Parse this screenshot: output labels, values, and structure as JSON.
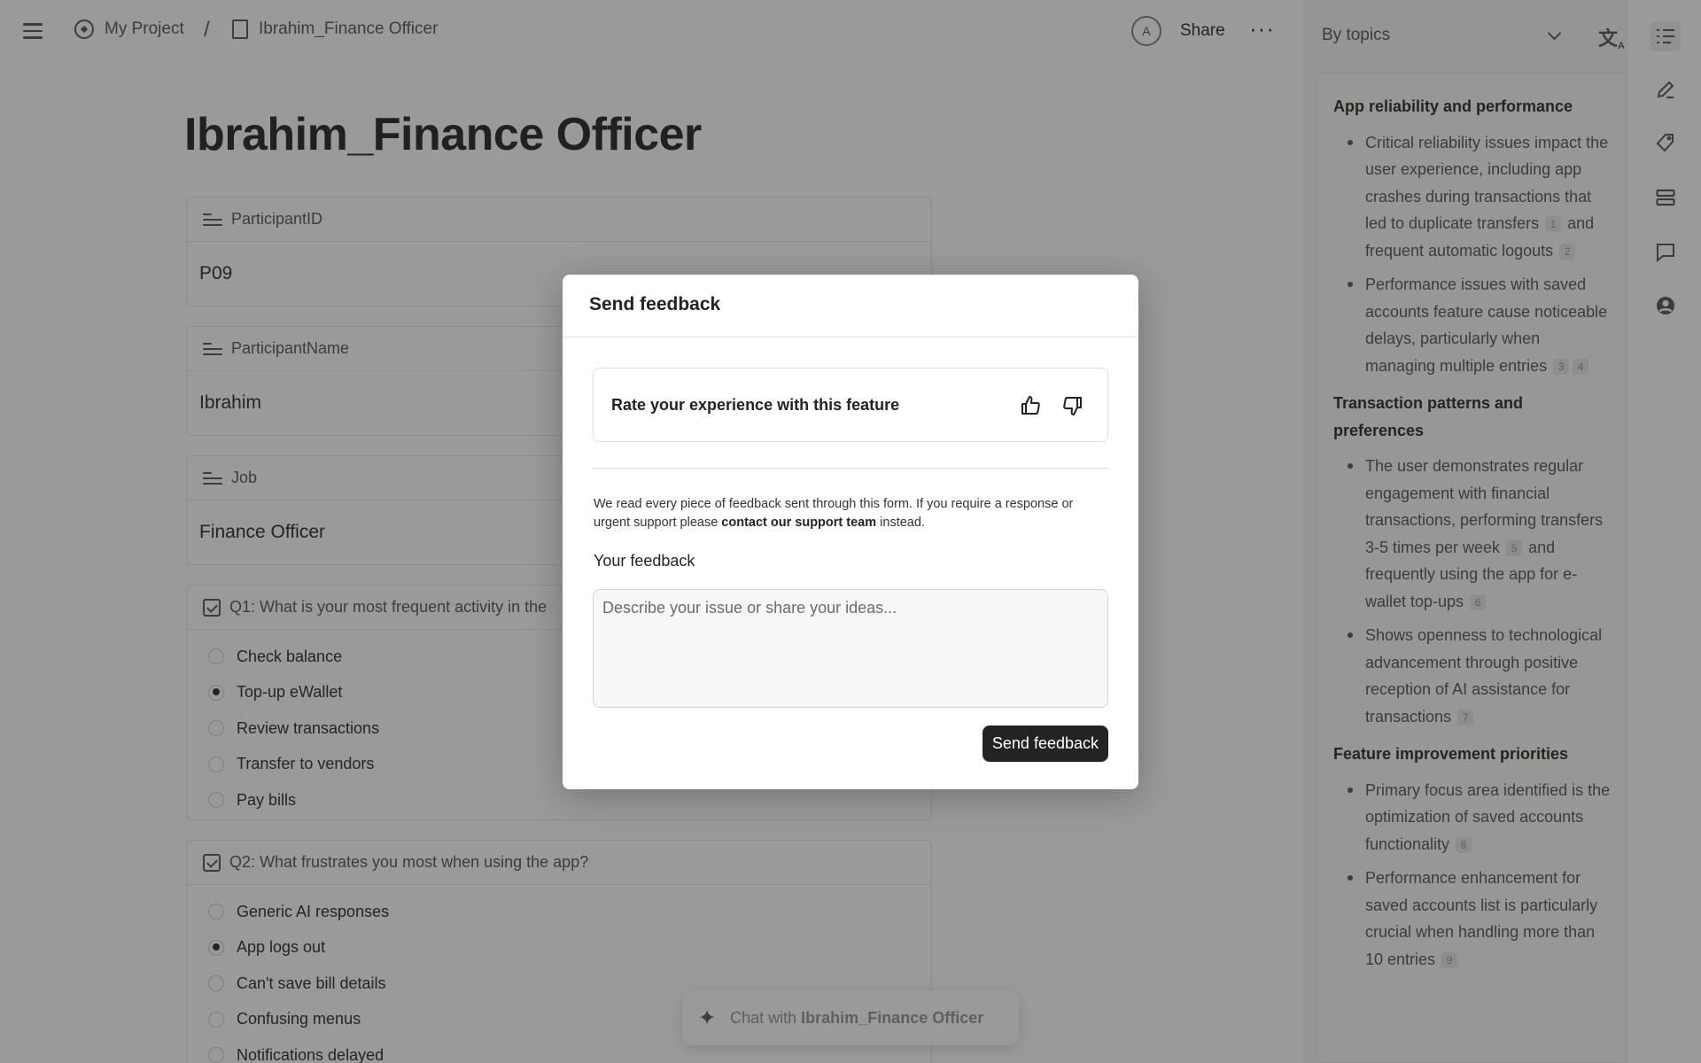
{
  "breadcrumb": {
    "project": "My Project",
    "separator": "/",
    "page": "Ibrahim_Finance Officer"
  },
  "topbar": {
    "avatar_initial": "A",
    "share_label": "Share",
    "more_label": "···"
  },
  "document": {
    "title": "Ibrahim_Finance Officer",
    "properties": [
      {
        "label": "ParticipantID",
        "value": "P09"
      },
      {
        "label": "ParticipantName",
        "value": "Ibrahim"
      },
      {
        "label": "Job",
        "value": "Finance Officer"
      }
    ],
    "questions": [
      {
        "label": "Q1: What is your most frequent activity in the",
        "options": [
          {
            "label": "Check balance",
            "selected": false
          },
          {
            "label": "Top-up eWallet",
            "selected": true
          },
          {
            "label": "Review transactions",
            "selected": false
          },
          {
            "label": "Transfer to vendors",
            "selected": false
          },
          {
            "label": "Pay bills",
            "selected": false
          }
        ]
      },
      {
        "label": "Q2: What frustrates you most when using the app?",
        "options": [
          {
            "label": "Generic AI responses",
            "selected": false
          },
          {
            "label": "App logs out",
            "selected": true
          },
          {
            "label": "Can't save bill details",
            "selected": false
          },
          {
            "label": "Confusing menus",
            "selected": false
          },
          {
            "label": "Notifications delayed",
            "selected": false
          }
        ]
      }
    ]
  },
  "chat": {
    "prefix": "Chat with",
    "target": "Ibrahim_Finance Officer"
  },
  "summary_panel": {
    "mode": "By topics",
    "sections": [
      {
        "heading": "App reliability and performance",
        "points": [
          {
            "text_a": "Critical reliability issues impact the user experience, including app crashes during transactions that led to duplicate transfers",
            "cite_a": "1",
            "text_b": "and frequent automatic logouts",
            "cite_b": "2"
          },
          {
            "text_a": "Performance issues with saved accounts feature cause noticeable delays, particularly when managing multiple entries",
            "cite_a": "3",
            "text_b": "",
            "cite_b": "4"
          }
        ]
      },
      {
        "heading": "Transaction patterns and preferences",
        "points": [
          {
            "text_a": "The user demonstrates regular engagement with financial transactions, performing transfers 3-5 times per week",
            "cite_a": "5",
            "text_b": "and frequently using the app for e-wallet top-ups",
            "cite_b": "6"
          },
          {
            "text_a": "Shows openness to technological advancement through positive reception of AI assistance for transactions",
            "cite_a": "7",
            "text_b": "",
            "cite_b": ""
          }
        ]
      },
      {
        "heading": "Feature improvement priorities",
        "points": [
          {
            "text_a": "Primary focus area identified is the optimization of saved accounts functionality",
            "cite_a": "8",
            "text_b": "",
            "cite_b": ""
          },
          {
            "text_a": "Performance enhancement for saved accounts list is particularly crucial when handling more than 10 entries",
            "cite_a": "9",
            "text_b": "",
            "cite_b": ""
          }
        ]
      }
    ]
  },
  "dialog": {
    "title": "Send feedback",
    "rate_prompt": "Rate your experience with this feature",
    "note_text": "We read every piece of feedback sent through this form. If you require a response or urgent support please",
    "note_link": "contact our support team",
    "note_suffix": "instead.",
    "feedback_label": "Your feedback",
    "feedback_placeholder": "Describe your issue or share your ideas...",
    "feedback_value": "",
    "submit_label": "Send feedback"
  },
  "colors": {
    "overlay": "#0f0f0f",
    "button_bg": "#232323",
    "panel_bg": "#f7f7f5"
  },
  "icons": {
    "menu": "hamburger-icon",
    "project": "compass-icon",
    "page": "document-icon",
    "more": "more-dots-icon",
    "dropdown": "chevron-down-icon",
    "translate": "translate-icon",
    "rail": [
      "list-icon",
      "pen-icon",
      "tag-icon",
      "stack-icon",
      "comment-icon",
      "person-icon"
    ],
    "thumbs_up": "thumbs-up-icon",
    "thumbs_down": "thumbs-down-icon",
    "chat": "sparkle-icon"
  }
}
